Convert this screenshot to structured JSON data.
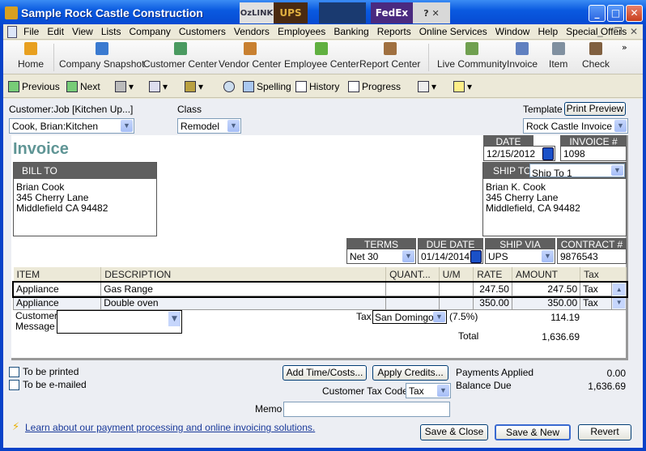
{
  "window": {
    "title": "Sample Rock Castle Construction",
    "logos": [
      "OzLINK",
      "UPS",
      "USPS",
      "FedEx",
      "? ✕"
    ],
    "controls": [
      "_",
      "□",
      "✕"
    ]
  },
  "menu": [
    "File",
    "Edit",
    "View",
    "Lists",
    "Company",
    "Customers",
    "Vendors",
    "Employees",
    "Banking",
    "Reports",
    "Online Services",
    "Window",
    "Help",
    "Special Offers"
  ],
  "icon_bar": [
    {
      "label": "Home",
      "icon": "house-icon",
      "color": "#e8a020"
    },
    {
      "label": "Company Snapshot",
      "icon": "snapshot-icon",
      "color": "#3a7ad0"
    },
    {
      "label": "Customer Center",
      "icon": "customer-icon",
      "color": "#4a9a60"
    },
    {
      "label": "Vendor Center",
      "icon": "vendor-icon",
      "color": "#c88030"
    },
    {
      "label": "Employee Center",
      "icon": "employee-icon",
      "color": "#60b040"
    },
    {
      "label": "Report Center",
      "icon": "report-icon",
      "color": "#a07040"
    },
    {
      "label": "Live Community",
      "icon": "community-icon",
      "color": "#70a050"
    },
    {
      "label": "Invoice",
      "icon": "invoice-icon",
      "color": "#6080c0"
    },
    {
      "label": "Item",
      "icon": "item-icon",
      "color": "#8090a0"
    },
    {
      "label": "Check",
      "icon": "check-icon",
      "color": "#806040"
    }
  ],
  "toolbar": {
    "previous": "Previous",
    "next": "Next",
    "spelling": "Spelling",
    "history": "History",
    "progress": "Progress"
  },
  "form": {
    "customer_job_label": "Customer:Job",
    "job_hint": "[Kitchen Up...]",
    "customer_job": "Cook, Brian:Kitchen",
    "class_label": "Class",
    "class": "Remodel",
    "template_label": "Template",
    "print_preview": "Print Preview",
    "template": "Rock Castle Invoice",
    "heading": "Invoice",
    "date_label": "DATE",
    "date": "12/15/2012",
    "invoice_no_label": "INVOICE #",
    "invoice_no": "1098",
    "bill_to_label": "BILL TO",
    "bill_to": [
      "Brian Cook",
      "345 Cherry Lane",
      "Middlefield CA 94482"
    ],
    "ship_to_label": "SHIP TO",
    "ship_to_select": "Ship To 1",
    "ship_to": [
      "Brian K. Cook",
      "345 Cherry Lane",
      "Middlefield, CA 94482"
    ],
    "terms_label": "TERMS",
    "terms": "Net 30",
    "due_date_label": "DUE DATE",
    "due_date": "01/14/2014",
    "ship_via_label": "SHIP VIA",
    "ship_via": "UPS",
    "contract_label": "CONTRACT #",
    "contract": "9876543",
    "columns": [
      "ITEM",
      "DESCRIPTION",
      "QUANT...",
      "U/M",
      "RATE",
      "AMOUNT",
      "Tax"
    ],
    "rows": [
      {
        "item": "Appliance",
        "description": "Gas Range",
        "qty": "",
        "um": "",
        "rate": "247.50",
        "amount": "247.50",
        "tax": "Tax"
      },
      {
        "item": "Appliance",
        "description": "Double oven",
        "qty": "",
        "um": "",
        "rate": "350.00",
        "amount": "350.00",
        "tax": "Tax"
      }
    ],
    "customer_message_label": [
      "Customer",
      "Message"
    ],
    "tax_label": "Tax",
    "tax_item": "San Domingo",
    "tax_rate": "(7.5%)",
    "tax_amount": "114.19",
    "total_label": "Total",
    "total": "1,636.69",
    "to_be_printed": "To be printed",
    "to_be_emailed": "To be e-mailed",
    "add_time_costs": "Add Time/Costs...",
    "apply_credits": "Apply Credits...",
    "payments_applied_label": "Payments Applied",
    "payments_applied": "0.00",
    "balance_due_label": "Balance Due",
    "balance_due": "1,636.69",
    "customer_tax_code_label": "Customer Tax Code",
    "customer_tax_code": "Tax",
    "memo_label": "Memo",
    "memo": "",
    "learn_link": "Learn about our payment processing and online invoicing solutions.",
    "save_close": "Save & Close",
    "save_new": "Save & New",
    "revert": "Revert"
  }
}
